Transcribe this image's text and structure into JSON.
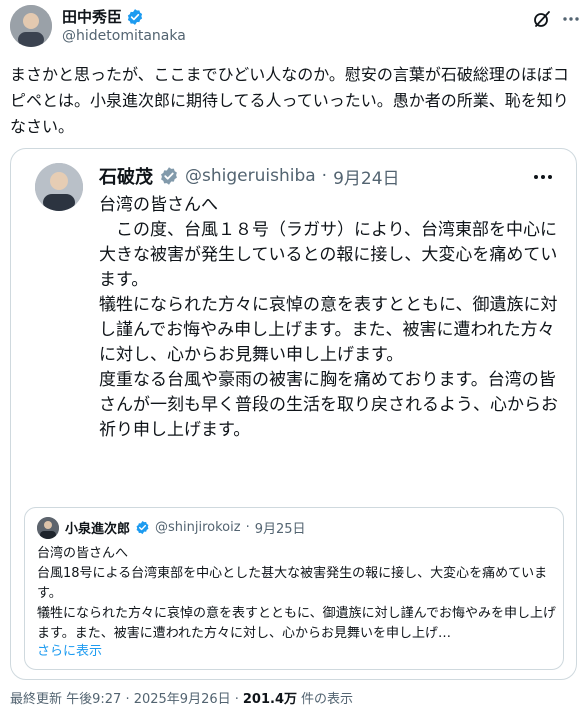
{
  "author": {
    "name": "田中秀臣",
    "handle": "@hidetomitanaka"
  },
  "post_text": "まさかと思ったが、ここまでひどい人なのか。慰安の言葉が石破総理のほぼコピペとは。小泉進次郎に期待してる人っていったい。愚か者の所業、恥を知りなさい。",
  "quoted": {
    "name": "石破茂",
    "handle": "@shigeruishiba",
    "separator": "·",
    "date": "9月24日",
    "paragraphs": [
      "台湾の皆さんへ",
      "　この度、台風１８号（ラガサ）により、台湾東部を中心に大きな被害が発生しているとの報に接し、大変心を痛めています。",
      "犠牲になられた方々に哀悼の意を表すとともに、御遺族に対し謹んでお悔やみ申し上げます。また、被害に遭われた方々に対し、心からお見舞い申し上げます。",
      "度重なる台風や豪雨の被害に胸を痛めております。台湾の皆さんが一刻も早く普段の生活を取り戻されるよう、心からお祈り申し上げます。"
    ],
    "nested": {
      "name": "小泉進次郎",
      "handle": "@shinjirokoiz",
      "separator": "·",
      "date": "9月25日",
      "lines": [
        "台湾の皆さんへ",
        "台風18号による台湾東部を中心とした甚大な被害発生の報に接し、大変心を痛めています。",
        "犠牲になられた方々に哀悼の意を表すとともに、御遺族に対し謹んでお悔やみを申し上げます。また、被害に遭われた方々に対し、心からお見舞いを申し上げ…"
      ],
      "show_more": "さらに表示"
    }
  },
  "footer": {
    "timestamp": "最終更新 午後9:27 · 2025年9月26日 ·",
    "views_count": "201.4万",
    "views_label": "件の表示"
  },
  "colors": {
    "verified_blue": "#1d9bf0",
    "gov_gray": "#829aab",
    "link": "#1d9bf0",
    "secondary_text": "#536471",
    "border": "#cfd9de"
  },
  "icons": [
    "verified-badge-icon",
    "grok-icon",
    "more-icon",
    "government-badge-icon"
  ]
}
